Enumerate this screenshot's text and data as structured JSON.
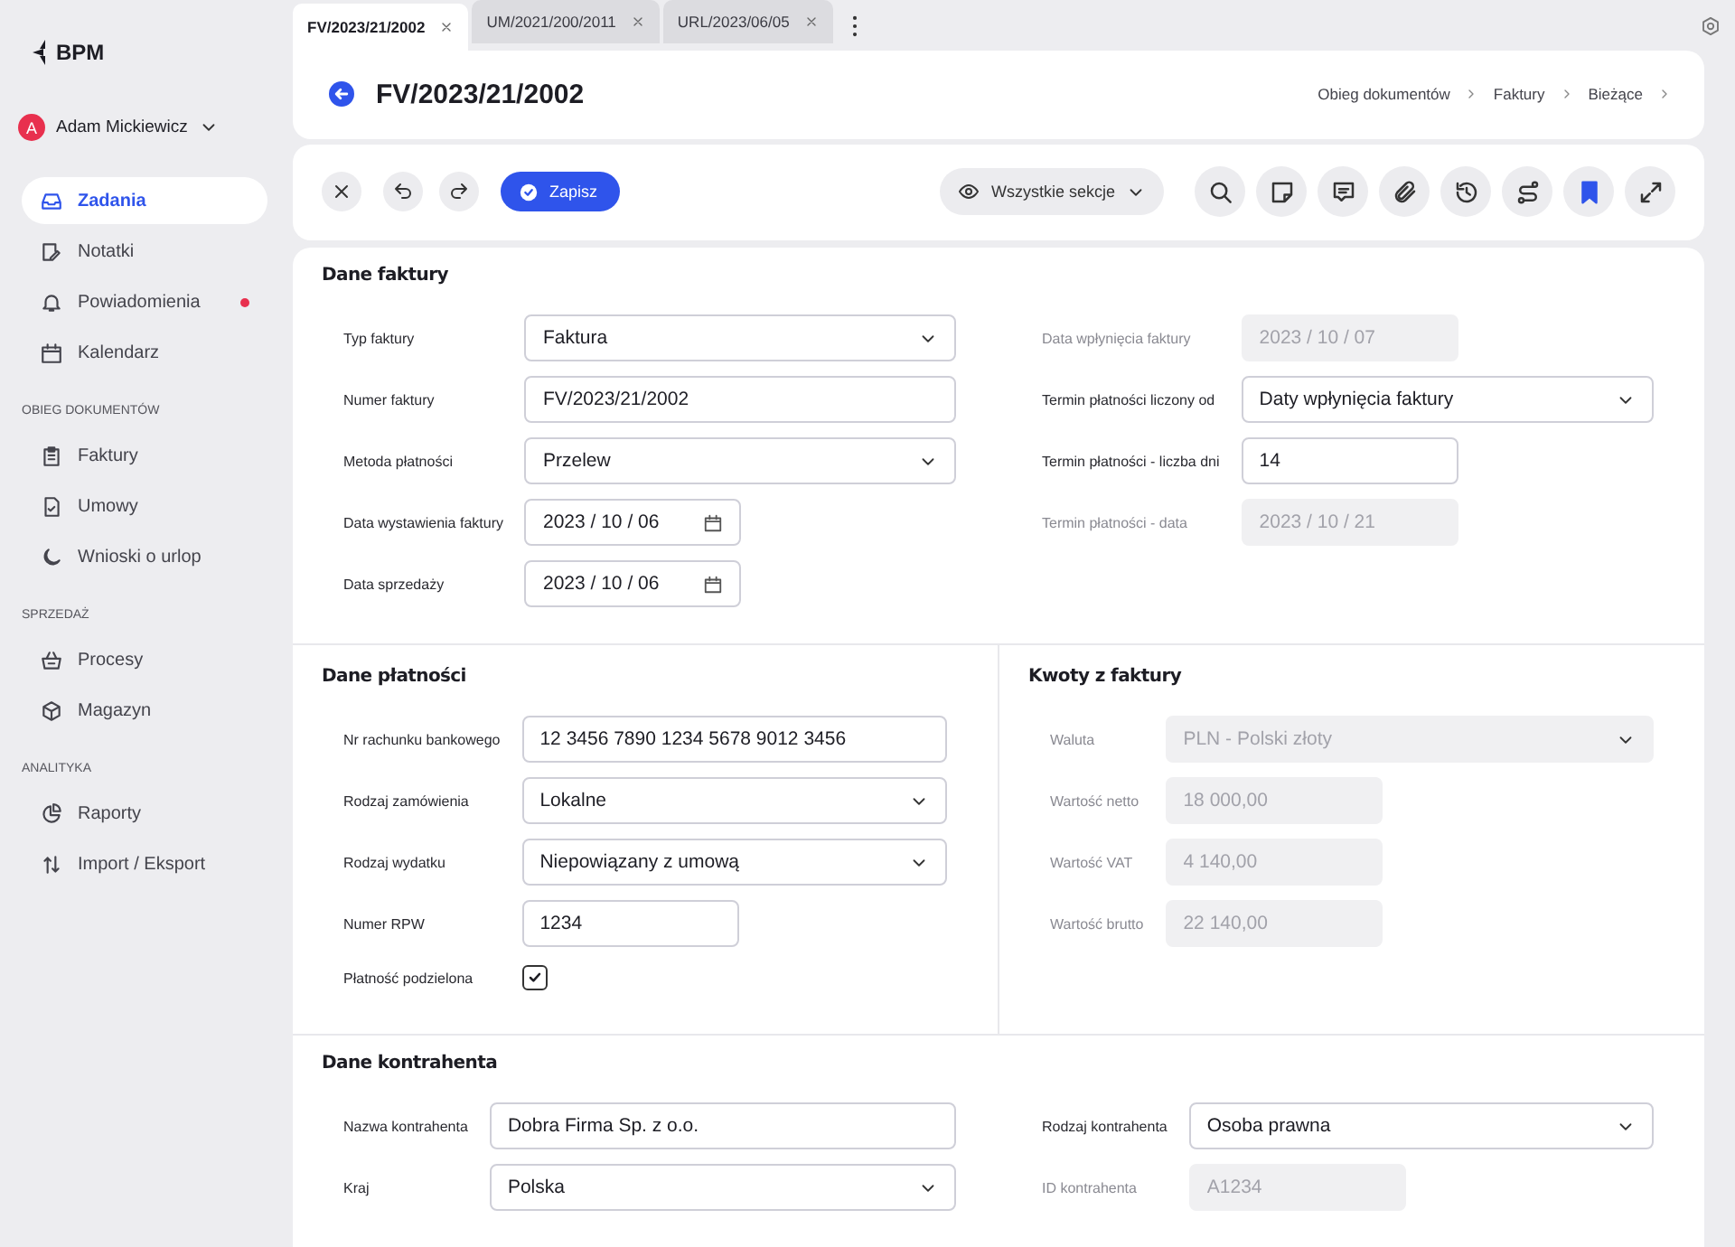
{
  "sidebar": {
    "logo": "BPM",
    "user": {
      "initial": "A",
      "name": "Adam Mickiewicz"
    },
    "groups": [
      {
        "items": [
          {
            "label": "Zadania",
            "selected": true,
            "notification": false
          },
          {
            "label": "Notatki",
            "selected": false,
            "notification": false
          },
          {
            "label": "Powiadomienia",
            "selected": false,
            "notification": true
          },
          {
            "label": "Kalendarz",
            "selected": false,
            "notification": false
          }
        ]
      },
      {
        "heading": "OBIEG DOKUMENTÓW",
        "items": [
          {
            "label": "Faktury",
            "selected": false,
            "notification": false
          },
          {
            "label": "Umowy",
            "selected": false,
            "notification": false
          },
          {
            "label": "Wnioski o urlop",
            "selected": false,
            "notification": false
          }
        ]
      },
      {
        "heading": "SPRZEDAŻ",
        "items": [
          {
            "label": "Procesy",
            "selected": false,
            "notification": false
          },
          {
            "label": "Magazyn",
            "selected": false,
            "notification": false
          }
        ]
      },
      {
        "heading": "ANALITYKA",
        "items": [
          {
            "label": "Raporty",
            "selected": false,
            "notification": false
          },
          {
            "label": "Import / Eksport",
            "selected": false,
            "notification": false
          }
        ]
      }
    ]
  },
  "tabs": [
    {
      "label": "FV/2023/21/2002",
      "selected": true
    },
    {
      "label": "UM/2021/200/2011",
      "selected": false
    },
    {
      "label": "URL/2023/06/05",
      "selected": false
    }
  ],
  "header": {
    "title": "FV/2023/21/2002",
    "breadcrumbs": [
      "Obieg dokumentów",
      "Faktury",
      "Bieżące"
    ]
  },
  "toolbar": {
    "save": "Zapisz",
    "sections": "Wszystkie sekcje",
    "bookmarked": true
  },
  "sections": [
    {
      "kind": "columns",
      "title": "Dane faktury",
      "blocks": [
        {
          "fields": [
            {
              "label": "Typ faktury",
              "kind": "select",
              "value": "Faktura",
              "wide": true,
              "disabled": false
            },
            {
              "label": "Numer faktury",
              "kind": "text",
              "value": "FV/2023/21/2002",
              "wide": true,
              "disabled": false
            },
            {
              "label": "Metoda płatności",
              "kind": "select",
              "value": "Przelew",
              "wide": true,
              "disabled": false
            },
            {
              "label": "Data wystawienia faktury",
              "kind": "date",
              "value": "2023 / 10 / 06",
              "wide": false,
              "disabled": false
            },
            {
              "label": "Data sprzedaży",
              "kind": "date",
              "value": "2023 / 10 / 06",
              "wide": false,
              "disabled": false
            }
          ]
        },
        {
          "fields": [
            {
              "label": "Data wpłynięcia faktury",
              "kind": "text",
              "value": "2023 / 10 / 07",
              "wide": false,
              "disabled": true
            },
            {
              "label": "Termin płatności liczony od",
              "kind": "select",
              "value": "Daty wpłynięcia faktury",
              "wide": true,
              "disabled": false
            },
            {
              "label": "Termin płatności - liczba dni",
              "kind": "text",
              "value": "14",
              "wide": false,
              "disabled": false
            },
            {
              "label": "Termin płatności - data",
              "kind": "text",
              "value": "2023 / 10 / 21",
              "wide": false,
              "disabled": true
            }
          ]
        }
      ]
    },
    {
      "kind": "split",
      "blocks": [
        {
          "title": "Dane płatności",
          "fields": [
            {
              "label": "Nr rachunku bankowego",
              "kind": "text",
              "value": "12 3456 7890 1234 5678 9012 3456",
              "wide": true,
              "disabled": false
            },
            {
              "label": "Rodzaj zamówienia",
              "kind": "select",
              "value": "Lokalne",
              "wide": true,
              "disabled": false
            },
            {
              "label": "Rodzaj wydatku",
              "kind": "select",
              "value": "Niepowiązany z umową",
              "wide": true,
              "disabled": false
            },
            {
              "label": "Numer RPW",
              "kind": "text",
              "value": "1234",
              "wide": false,
              "disabled": false
            },
            {
              "label": "Płatność podzielona",
              "kind": "checkbox",
              "checked": true,
              "disabled": false
            }
          ]
        },
        {
          "title": "Kwoty z faktury",
          "fields": [
            {
              "label": "Waluta",
              "kind": "select",
              "value": "PLN - Polski złoty",
              "wide": true,
              "disabled": true
            },
            {
              "label": "Wartość netto",
              "kind": "text",
              "value": "18 000,00",
              "wide": false,
              "disabled": true
            },
            {
              "label": "Wartość VAT",
              "kind": "text",
              "value": "4 140,00",
              "wide": false,
              "disabled": true
            },
            {
              "label": "Wartość brutto",
              "kind": "text",
              "value": "22 140,00",
              "wide": false,
              "disabled": true
            }
          ]
        }
      ]
    },
    {
      "kind": "columns",
      "title": "Dane kontrahenta",
      "blocks": [
        {
          "fields": [
            {
              "label": "Nazwa kontrahenta",
              "kind": "text",
              "value": "Dobra Firma Sp. z o.o.",
              "wide": true,
              "disabled": false
            },
            {
              "label": "Kraj",
              "kind": "select",
              "value": "Polska",
              "wide": true,
              "disabled": false
            }
          ]
        },
        {
          "fields": [
            {
              "label": "Rodzaj kontrahenta",
              "kind": "select",
              "value": "Osoba prawna",
              "wide": true,
              "disabled": false
            },
            {
              "label": "ID kontrahenta",
              "kind": "text",
              "value": "A1234",
              "wide": false,
              "disabled": true
            }
          ]
        }
      ]
    }
  ]
}
